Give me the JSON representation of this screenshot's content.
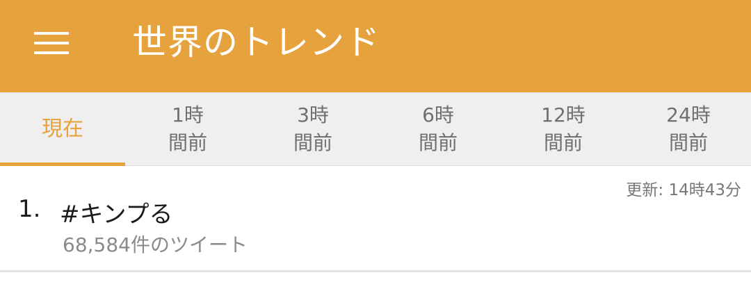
{
  "appbar": {
    "title": "世界のトレンド",
    "menu_icon": "hamburger-menu-icon",
    "background_color": "#E6A23C"
  },
  "tabs": [
    {
      "line1": "現在",
      "line2": "",
      "active": true
    },
    {
      "line1": "1時",
      "line2": "間前",
      "active": false
    },
    {
      "line1": "3時",
      "line2": "間前",
      "active": false
    },
    {
      "line1": "6時",
      "line2": "間前",
      "active": false
    },
    {
      "line1": "12時",
      "line2": "間前",
      "active": false
    },
    {
      "line1": "24時",
      "line2": "間前",
      "active": false
    }
  ],
  "updated": "更新: 14時43分",
  "trends": [
    {
      "rank": "1.",
      "name": "#キンプる",
      "tweet_count": "68,584件のツイート"
    }
  ],
  "colors": {
    "accent": "#E6A23C",
    "tab_background": "#EFEFEF",
    "tab_inactive_text": "#6f6f6f"
  }
}
